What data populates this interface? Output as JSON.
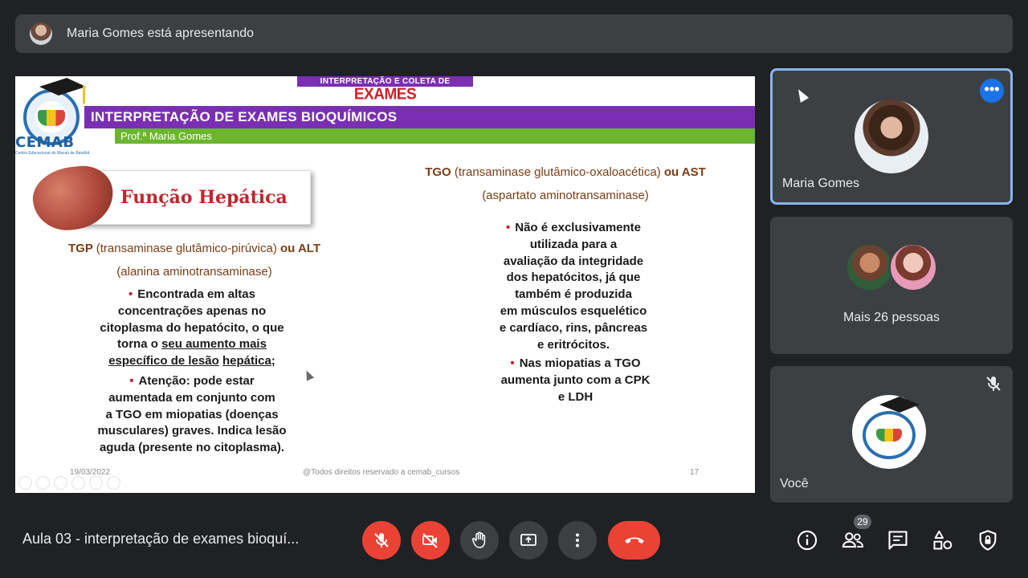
{
  "banner": {
    "text": "Maria Gomes está apresentando"
  },
  "slide": {
    "logo_name": "CEMAB",
    "logo_sub": "Centro Educacional do Macaú de Batalhã",
    "badge_line1": "INTERPRETAÇÃO E COLETA DE",
    "badge_line2": "EXAMES LABORATORIAIS",
    "main_title": "INTERPRETAÇÃO DE EXAMES BIOQUÍMICOS",
    "professor": "Prof.ª Maria Gomes",
    "section_title": "Função Hepática",
    "left": {
      "title_a": "TGP",
      "title_b": "(transaminase glutâmico-pirúvica)",
      "title_c": "ou ALT",
      "title_d": "(alanina aminotransaminase)",
      "p1_lines": [
        "Encontrada em altas",
        "concentrações apenas no",
        "citoplasma do hepatócito, o que",
        "torna o"
      ],
      "p1_u1": "seu aumento mais",
      "p1_u2": "específico de lesão",
      "p1_u3": "hepática",
      "p1_end": ";",
      "p2_lines": [
        "Atenção: pode estar",
        "aumentada em conjunto com",
        "a TGO em miopatias (doenças",
        "musculares) graves. Indica lesão",
        "aguda (presente no citoplasma)."
      ]
    },
    "right": {
      "title_a": "TGO",
      "title_b": "(transaminase glutâmico-oxaloacética)",
      "title_c": "ou AST",
      "title_d": "(aspartato aminotransaminase)",
      "p3_lines": [
        "Não é exclusivamente",
        "utilizada para a",
        "avaliação da integridade",
        "dos hepatócitos, já que",
        "também é produzida",
        "em músculos esquelético",
        "e cardíaco, rins, pâncreas",
        "e eritrócitos."
      ],
      "p4_lines": [
        "Nas miopatias a TGO",
        "aumenta junto com a CPK",
        "e LDH"
      ]
    },
    "footer_date": "19/03/2022",
    "footer_copy": "@Todos direitos reservado a cemab_cursos",
    "footer_page": "17"
  },
  "tiles": {
    "presenter": "Maria Gomes",
    "others": "Mais 26 pessoas",
    "self": "Você"
  },
  "controls": {
    "meeting_title": "Aula 03 - interpretação de exames bioquí...",
    "participants_count": "29"
  },
  "colors": {
    "brand_purple": "#7a2fb3",
    "brand_green": "#6cb52f",
    "accent_red": "#ea4335",
    "accent_blue": "#1a73e8"
  }
}
